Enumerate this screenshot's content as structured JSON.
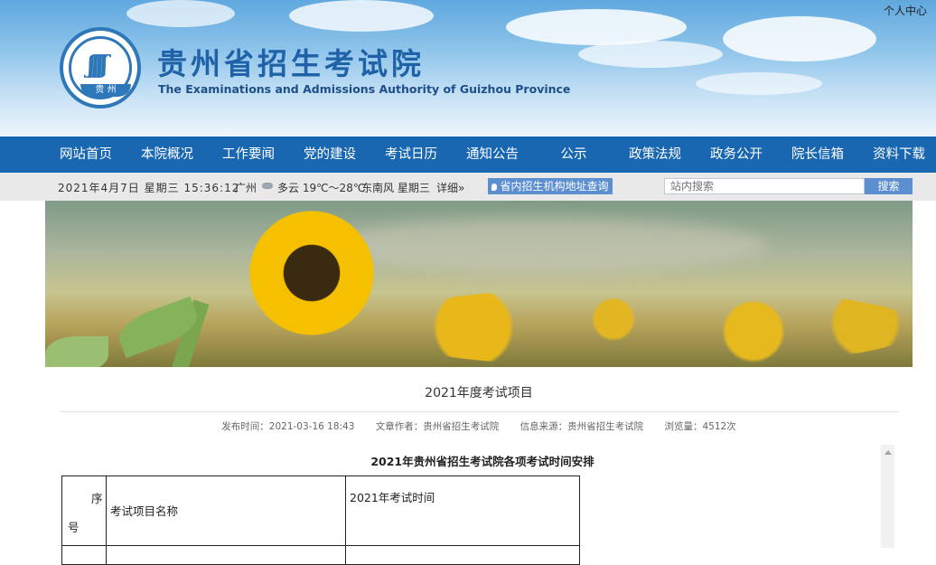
{
  "header": {
    "user_center": "个人中心",
    "logo_band_text": "贵 州",
    "site_name_cn": "贵州省招生考试院",
    "site_name_en": "The Examinations and Admissions Authority of Guizhou Province"
  },
  "nav": {
    "items": [
      "网站首页",
      "本院概况",
      "工作要闻",
      "党的建设",
      "考试日历",
      "通知公告",
      "公示",
      "政策法规",
      "政务公开",
      "院长信箱",
      "资料下载"
    ]
  },
  "infobar": {
    "date": "2021年4月7日 星期三 15:36:12",
    "city": "广州",
    "weather": "多云 19℃～28℃",
    "wind": "东南风 星期三",
    "detail": "详细»",
    "query_button": "省内招生机构地址查询",
    "search_placeholder": "站内搜索",
    "search_button": "搜索",
    "weather_icon": "cloud-icon"
  },
  "article": {
    "title": "2021年度考试项目",
    "publish_time": "发布时间：2021-03-16 18:43",
    "author": "文章作者：贵州省招生考试院",
    "source": "信息来源：贵州省招生考试院",
    "views": "浏览量：4512次",
    "content_title": "2021年贵州省招生考试院各项考试时间安排",
    "table_header": {
      "seq_line1": "序",
      "seq_line2": "号",
      "name": "考试项目名称",
      "time": "2021年考试时间"
    }
  },
  "colors": {
    "nav_bg": "#1a67b1",
    "brand_blue": "#1f62a8",
    "button_blue": "#5b8fd0"
  }
}
